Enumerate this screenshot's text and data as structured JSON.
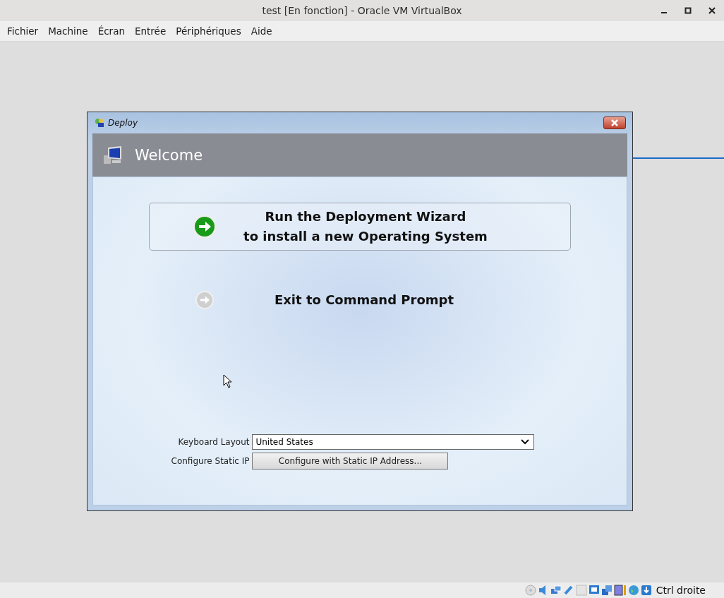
{
  "window": {
    "title": "test [En fonction] - Oracle VM VirtualBox"
  },
  "menu": [
    "Fichier",
    "Machine",
    "Écran",
    "Entrée",
    "Périphériques",
    "Aide"
  ],
  "dialog": {
    "title": "Deploy",
    "header": "Welcome",
    "options": [
      {
        "lines": [
          "Run the Deployment Wizard",
          "to install a new Operating System"
        ],
        "selected": true
      },
      {
        "lines": [
          "Exit to Command Prompt"
        ],
        "selected": false
      }
    ],
    "keyboard_layout": {
      "label": "Keyboard Layout",
      "value": "United States"
    },
    "static_ip": {
      "label": "Configure Static IP",
      "button": "Configure with Static IP Address..."
    }
  },
  "status_bar": {
    "host_key": "Ctrl droite"
  }
}
